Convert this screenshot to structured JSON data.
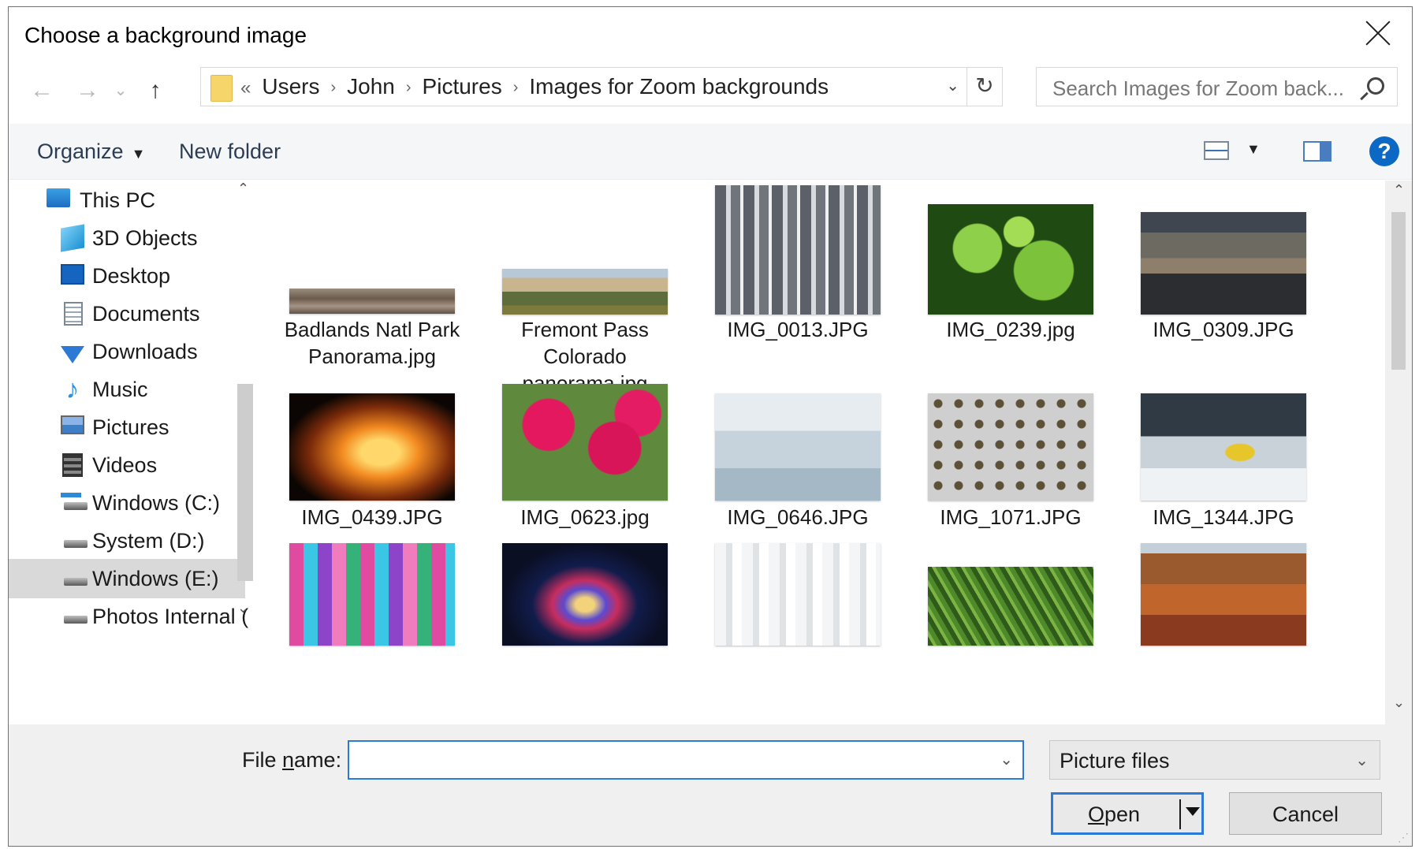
{
  "window": {
    "title": "Choose a background image"
  },
  "nav": {
    "back": "←",
    "forward": "→",
    "recent": "⌄",
    "up": "↑"
  },
  "address": {
    "overflow": "«",
    "crumbs": [
      "Users",
      "John",
      "Pictures",
      "Images for Zoom backgrounds"
    ],
    "separator": "›",
    "dropdown": "⌄",
    "refresh": "↻"
  },
  "search": {
    "placeholder": "Search Images for Zoom back..."
  },
  "toolbar": {
    "organize": "Organize",
    "organize_caret": "▼",
    "new_folder": "New folder",
    "view_caret": "▼",
    "help": "?"
  },
  "sidebar": {
    "items": [
      {
        "label": "This PC",
        "icon": "computer-icon",
        "selected": false
      },
      {
        "label": "3D Objects",
        "icon": "cube-icon",
        "selected": false
      },
      {
        "label": "Desktop",
        "icon": "desktop-icon",
        "selected": false
      },
      {
        "label": "Documents",
        "icon": "document-icon",
        "selected": false
      },
      {
        "label": "Downloads",
        "icon": "download-arrow-icon",
        "selected": false
      },
      {
        "label": "Music",
        "icon": "music-note-icon",
        "selected": false
      },
      {
        "label": "Pictures",
        "icon": "pictures-icon",
        "selected": false
      },
      {
        "label": "Videos",
        "icon": "film-icon",
        "selected": false
      },
      {
        "label": "Windows (C:)",
        "icon": "windows-drive-icon",
        "selected": false
      },
      {
        "label": "System (D:)",
        "icon": "drive-icon",
        "selected": false
      },
      {
        "label": "Windows (E:)",
        "icon": "drive-icon",
        "selected": true
      },
      {
        "label": "Photos Internal (",
        "icon": "drive-icon",
        "selected": false
      }
    ],
    "scroll_up": "⌃",
    "scroll_down": "⌄"
  },
  "files": [
    {
      "name": "Badlands Natl Park Panorama.jpg"
    },
    {
      "name": "Fremont Pass Colorado panorama.jpg"
    },
    {
      "name": "IMG_0013.JPG"
    },
    {
      "name": "IMG_0239.jpg"
    },
    {
      "name": "IMG_0309.JPG"
    },
    {
      "name": "IMG_0439.JPG"
    },
    {
      "name": "IMG_0623.jpg"
    },
    {
      "name": "IMG_0646.JPG"
    },
    {
      "name": "IMG_1071.JPG"
    },
    {
      "name": "IMG_1344.JPG"
    },
    {
      "name": ""
    },
    {
      "name": ""
    },
    {
      "name": ""
    },
    {
      "name": ""
    },
    {
      "name": ""
    }
  ],
  "bottom": {
    "file_name_label_pre": "File ",
    "file_name_label_u": "n",
    "file_name_label_post": "ame:",
    "file_name_value": "",
    "filter": "Picture files",
    "open_u": "O",
    "open_rest": "pen",
    "cancel": "Cancel"
  }
}
